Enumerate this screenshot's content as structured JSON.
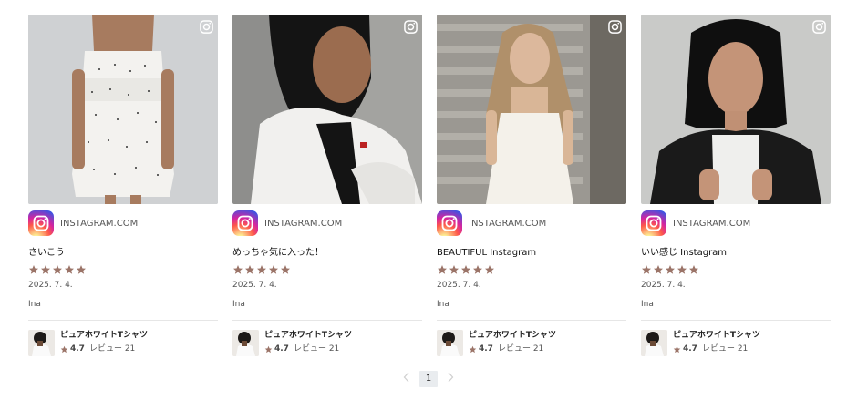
{
  "brand": {
    "instagram_gradient": [
      "#fdf497",
      "#fd5949",
      "#d6249f",
      "#285AEB"
    ],
    "star_color": "#9b7468"
  },
  "cards": [
    {
      "source": "INSTAGRAM.COM",
      "caption": "さいこう",
      "rating": 5,
      "date": "2025. 7. 4.",
      "author": "Ina",
      "product": {
        "name": "ピュアホワイトTシャツ",
        "score": "4.7",
        "reviews": "レビュー 21"
      }
    },
    {
      "source": "INSTAGRAM.COM",
      "caption": "めっちゃ気に入った！",
      "rating": 5,
      "date": "2025. 7. 4.",
      "author": "Ina",
      "product": {
        "name": "ピュアホワイトTシャツ",
        "score": "4.7",
        "reviews": "レビュー 21"
      }
    },
    {
      "source": "INSTAGRAM.COM",
      "caption": "BEAUTIFUL Instagram",
      "rating": 5,
      "date": "2025. 7. 4.",
      "author": "Ina",
      "product": {
        "name": "ピュアホワイトTシャツ",
        "score": "4.7",
        "reviews": "レビュー 21"
      }
    },
    {
      "source": "INSTAGRAM.COM",
      "caption": "いい感じ Instagram",
      "rating": 5,
      "date": "2025. 7. 4.",
      "author": "Ina",
      "product": {
        "name": "ピュアホワイトTシャツ",
        "score": "4.7",
        "reviews": "レビュー 21"
      }
    }
  ],
  "pagination": {
    "current": "1",
    "prev_icon": "chevron-left-icon",
    "next_icon": "chevron-right-icon"
  }
}
